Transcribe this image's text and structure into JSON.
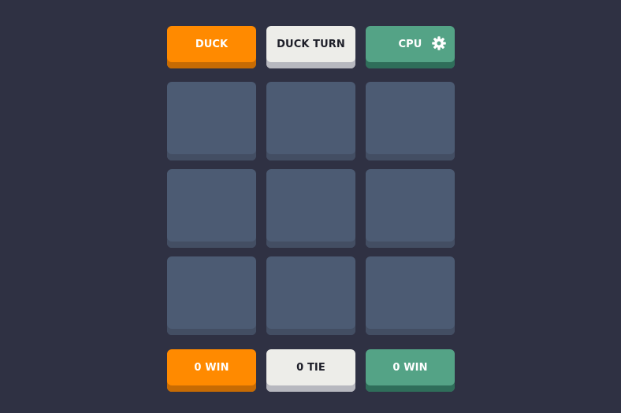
{
  "header": {
    "player_label": "DUCK",
    "turn_label": "DUCK TURN",
    "opponent_label": "CPU",
    "settings_icon": "gear-icon"
  },
  "board": {
    "cells": [
      "",
      "",
      "",
      "",
      "",
      "",
      "",
      "",
      ""
    ]
  },
  "scoreboard": {
    "player_wins": "0 WIN",
    "ties": "0 TIE",
    "opponent_wins": "0 WIN"
  },
  "colors": {
    "background": "#2f3143",
    "player": "#ff8a00",
    "neutral": "#edede9",
    "opponent": "#54a386",
    "cell": "#4c5b73"
  }
}
